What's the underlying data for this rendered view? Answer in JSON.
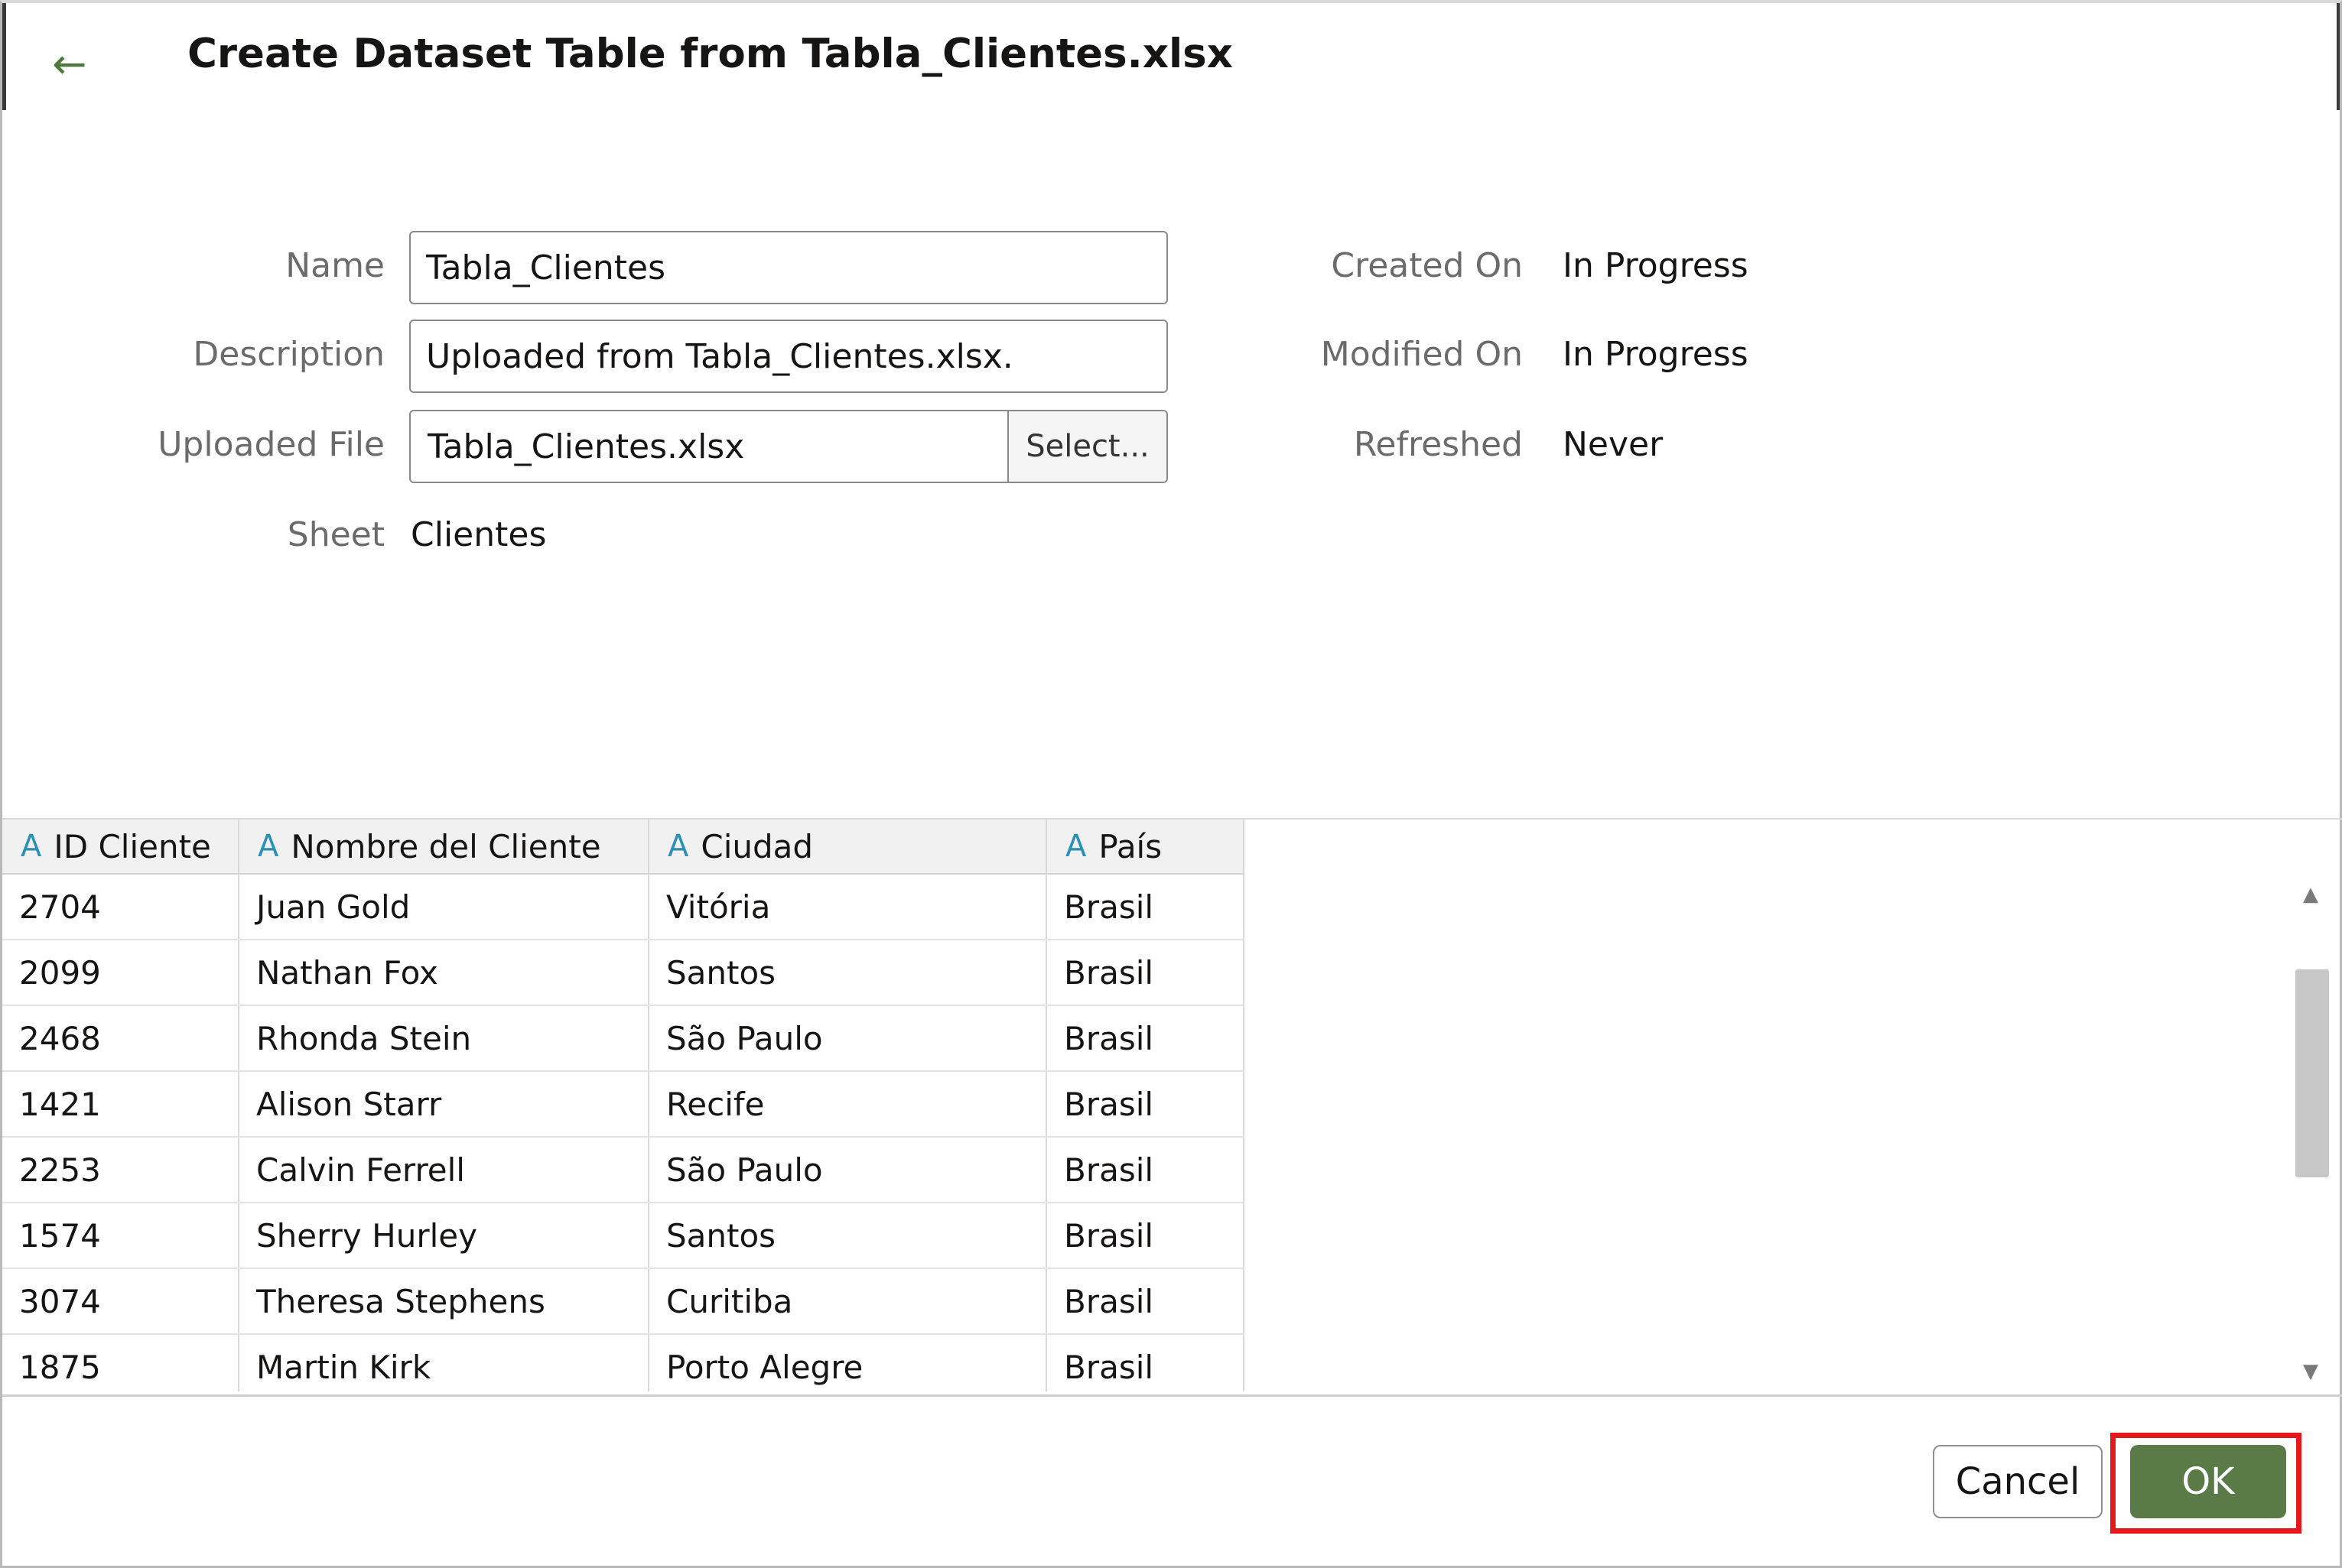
{
  "header": {
    "back_icon": "arrow-left-icon",
    "title": "Create Dataset Table from Tabla_Clientes.xlsx"
  },
  "form": {
    "name_label": "Name",
    "name_value": "Tabla_Clientes",
    "description_label": "Description",
    "description_value": "Uploaded from Tabla_Clientes.xlsx.",
    "uploaded_file_label": "Uploaded File",
    "uploaded_file_value": "Tabla_Clientes.xlsx",
    "select_label": "Select...",
    "sheet_label": "Sheet",
    "sheet_value": "Clientes"
  },
  "info": {
    "created_on_label": "Created On",
    "created_on_value": "In Progress",
    "modified_on_label": "Modified On",
    "modified_on_value": "In Progress",
    "refreshed_label": "Refreshed",
    "refreshed_value": "Never"
  },
  "table": {
    "type_marker": "A",
    "columns": [
      "ID Cliente",
      "Nombre del Cliente",
      "Ciudad",
      "País"
    ],
    "rows": [
      [
        "2704",
        "Juan Gold",
        "Vitória",
        "Brasil"
      ],
      [
        "2099",
        "Nathan Fox",
        "Santos",
        "Brasil"
      ],
      [
        "2468",
        "Rhonda Stein",
        "São Paulo",
        "Brasil"
      ],
      [
        "1421",
        "Alison Starr",
        "Recife",
        "Brasil"
      ],
      [
        "2253",
        "Calvin Ferrell",
        "São Paulo",
        "Brasil"
      ],
      [
        "1574",
        "Sherry Hurley",
        "Santos",
        "Brasil"
      ],
      [
        "3074",
        "Theresa Stephens",
        "Curitiba",
        "Brasil"
      ],
      [
        "1875",
        "Martin Kirk",
        "Porto Alegre",
        "Brasil"
      ]
    ]
  },
  "footer": {
    "cancel_label": "Cancel",
    "ok_label": "OK"
  },
  "colors": {
    "primary_button": "#5a7a48",
    "highlight": "#e5191b",
    "type_marker": "#2c8fb3"
  }
}
